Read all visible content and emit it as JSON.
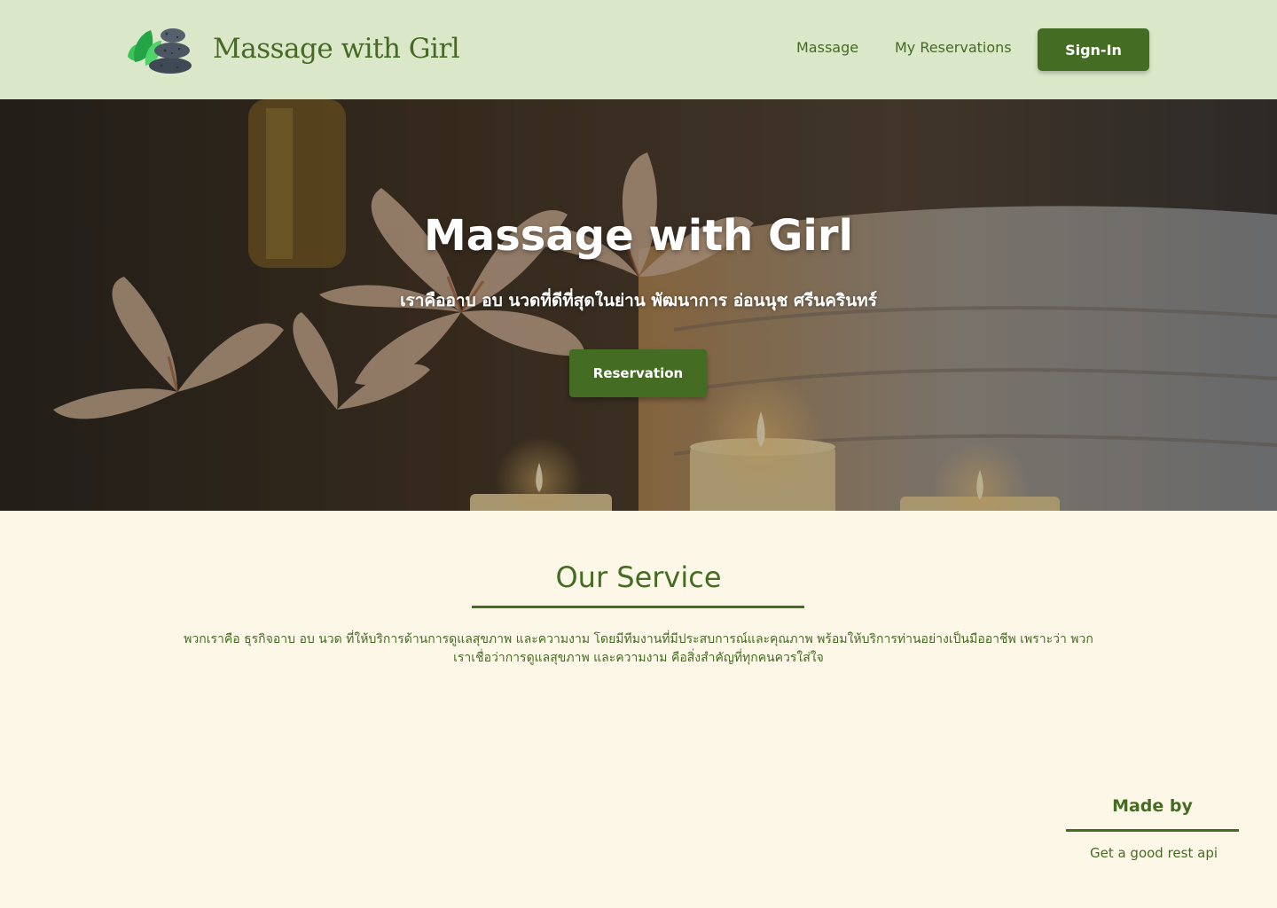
{
  "header": {
    "brand_name": "Massage with Girl",
    "nav": {
      "massage": "Massage",
      "my_reservations": "My Reservations",
      "sign_in": "Sign-In"
    }
  },
  "hero": {
    "title": "Massage with Girl",
    "subtitle": "เราคืออาบ อบ นวดที่ดีที่สุดในย่าน พัฒนาการ อ่อนนุช ศรีนครินทร์",
    "button": "Reservation"
  },
  "service": {
    "title": "Our Service",
    "description": "พวกเราคือ ธุรกิจอาบ อบ นวด ที่ให้บริการด้านการดูแลสุขภาพ และความงาม โดยมีทีมงานที่มีประสบการณ์และคุณภาพ พร้อมให้บริการท่านอย่างเป็นมืออาชีพ เพราะว่า พวกเราเชื่อว่าการดูแลสุขภาพ และความงาม คือสิ่งสำคัญที่ทุกคนควรใส่ใจ"
  },
  "footer": {
    "made_by_title": "Made by",
    "made_by_text": "Get a good rest api"
  },
  "colors": {
    "header_bg": "#dbe7c9",
    "brand_green": "#456c23",
    "page_bg": "#fdf7e8"
  },
  "icons": {
    "logo": "spa-stones-leaf-icon"
  }
}
